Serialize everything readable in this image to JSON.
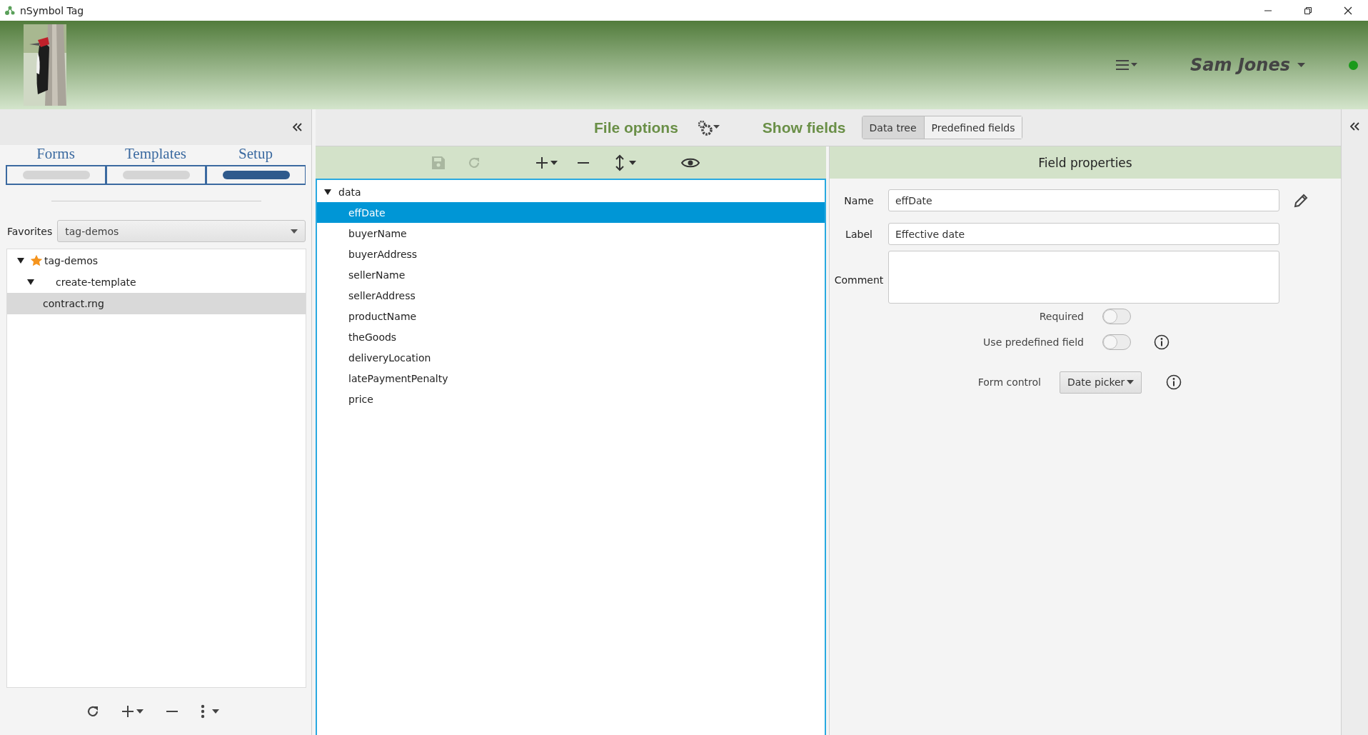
{
  "window": {
    "title": "nSymbol Tag"
  },
  "header": {
    "user": "Sam Jones",
    "online": true
  },
  "left_panel": {
    "tabs": [
      {
        "label": "Forms",
        "selected": false
      },
      {
        "label": "Templates",
        "selected": false
      },
      {
        "label": "Setup",
        "selected": true
      }
    ],
    "favorites": {
      "label": "Favorites",
      "value": "tag-demos"
    },
    "tree": [
      {
        "label": "tag-demos",
        "starred": true,
        "expanded": true,
        "selected": false,
        "children": [
          {
            "label": "create-template",
            "starred": false,
            "expanded": true,
            "selected": false,
            "children": [
              {
                "label": "contract.rng",
                "starred": false,
                "selected": true
              }
            ]
          }
        ]
      }
    ],
    "toolbar": [
      {
        "kind": "refresh"
      },
      {
        "kind": "add"
      },
      {
        "kind": "remove"
      },
      {
        "kind": "more"
      }
    ]
  },
  "options_bar": {
    "file_options": "File options",
    "show_fields": "Show fields",
    "views": [
      {
        "label": "Data tree",
        "selected": true
      },
      {
        "label": "Predefined fields",
        "selected": false
      }
    ]
  },
  "data_tree": {
    "toolbar": [
      {
        "kind": "save",
        "disabled": true
      },
      {
        "kind": "refresh",
        "disabled": true
      },
      {
        "kind": "add",
        "disabled": false
      },
      {
        "kind": "remove",
        "disabled": false
      },
      {
        "kind": "move",
        "disabled": false
      },
      {
        "kind": "preview",
        "disabled": false
      }
    ],
    "root": {
      "label": "data",
      "expanded": true,
      "selected": false,
      "children": [
        {
          "label": "effDate",
          "selected": true
        },
        {
          "label": "buyerName",
          "selected": false
        },
        {
          "label": "buyerAddress",
          "selected": false
        },
        {
          "label": "sellerName",
          "selected": false
        },
        {
          "label": "sellerAddress",
          "selected": false
        },
        {
          "label": "productName",
          "selected": false
        },
        {
          "label": "theGoods",
          "selected": false
        },
        {
          "label": "deliveryLocation",
          "selected": false
        },
        {
          "label": "latePaymentPenalty",
          "selected": false
        },
        {
          "label": "price",
          "selected": false
        }
      ]
    }
  },
  "field_properties": {
    "title": "Field properties",
    "name": {
      "label": "Name",
      "value": "effDate"
    },
    "label": {
      "label": "Label",
      "value": "Effective date"
    },
    "comment": {
      "label": "Comment"
    },
    "toggles": [
      {
        "label": "Required",
        "on": false,
        "info": false
      },
      {
        "label": "Use predefined field",
        "on": false,
        "info": true
      }
    ],
    "form_control": {
      "label": "Form control",
      "value": "Date picker",
      "info": true
    }
  }
}
